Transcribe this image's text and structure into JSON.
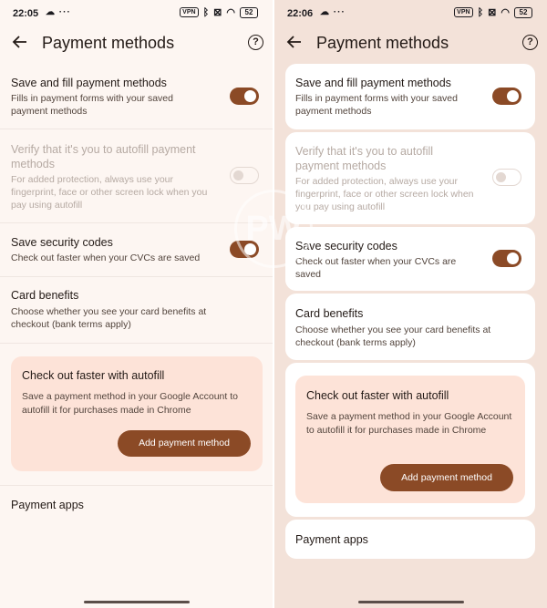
{
  "left": {
    "status": {
      "time": "22:05",
      "left_icons": "☁ ···",
      "vpn": "VPN",
      "battery": "52"
    },
    "header": {
      "title": "Payment methods"
    },
    "settings": [
      {
        "title": "Save and fill payment methods",
        "subtitle": "Fills in payment forms with your saved payment methods",
        "toggle": "on"
      },
      {
        "title": "Verify that it's you to autofill payment methods",
        "subtitle": "For added protection, always use your fingerprint, face or other screen lock when you pay using autofill",
        "toggle": "off-disabled"
      },
      {
        "title": "Save security codes",
        "subtitle": "Check out faster when your CVCs are saved",
        "toggle": "on"
      },
      {
        "title": "Card benefits",
        "subtitle": "Choose whether you see your card benefits at checkout (bank terms apply)"
      }
    ],
    "promo": {
      "title": "Check out faster with autofill",
      "body": "Save a payment method in your Google Account to autofill it for purchases made in Chrome",
      "button": "Add payment method"
    },
    "payment_apps": "Payment apps"
  },
  "right": {
    "status": {
      "time": "22:06",
      "left_icons": "☁ ···",
      "vpn": "VPN",
      "battery": "52"
    },
    "header": {
      "title": "Payment methods"
    },
    "settings": [
      {
        "title": "Save and fill payment methods",
        "subtitle": "Fills in payment forms with your saved payment methods",
        "toggle": "on"
      },
      {
        "title": "Verify that it's you to autofill payment methods",
        "subtitle": "For added protection, always use your fingerprint, face or other screen lock when you pay using autofill",
        "toggle": "off-disabled"
      },
      {
        "title": "Save security codes",
        "subtitle": "Check out faster when your CVCs are saved",
        "toggle": "on"
      },
      {
        "title": "Card benefits",
        "subtitle": "Choose whether you see your card benefits at checkout (bank terms apply)"
      }
    ],
    "promo": {
      "title": "Check out faster with autofill",
      "body": "Save a payment method in your Google Account to autofill it for purchases made in Chrome",
      "button": "Add payment method"
    },
    "payment_apps": "Payment apps"
  },
  "watermark": "PW",
  "colors": {
    "accent": "#8b4a26",
    "promo_bg": "#fde3d8",
    "left_bg": "#fdf6f2",
    "right_bg": "#f3e2d9"
  }
}
